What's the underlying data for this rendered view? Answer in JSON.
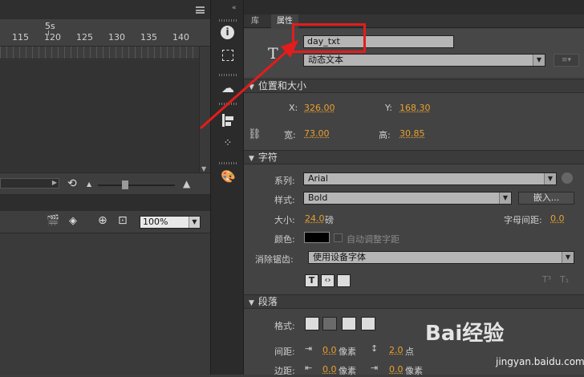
{
  "timeline": {
    "marker": "5s",
    "ruler": [
      "115",
      "120",
      "125",
      "130",
      "135",
      "140"
    ],
    "zoom": "100%"
  },
  "props": {
    "tabs": [
      "库",
      "属性"
    ],
    "instance_name": "day_txt",
    "text_type": "动态文本",
    "sections": {
      "position": "位置和大小",
      "character": "字符",
      "paragraph": "段落"
    },
    "position": {
      "x_label": "X:",
      "x": "326.00",
      "y_label": "Y:",
      "y": "168.30",
      "w_label": "宽:",
      "w": "73.00",
      "h_label": "高:",
      "h": "30.85"
    },
    "character": {
      "family_label": "系列:",
      "family": "Arial",
      "style_label": "样式:",
      "style": "Bold",
      "embed_button": "嵌入...",
      "size_label": "大小:",
      "size": "24.0",
      "size_unit": "磅",
      "letter_spacing_label": "字母间距:",
      "letter_spacing": "0.0",
      "color_label": "颜色:",
      "color": "#000000",
      "auto_kern": "自动调整字距",
      "antialias_label": "消除锯齿:",
      "antialias": "使用设备字体"
    },
    "paragraph": {
      "format_label": "格式:",
      "spacing_label": "间距:",
      "indent": "0.0",
      "indent_unit": "像素",
      "line_spacing": "2.0",
      "line_unit": "点",
      "margin_label": "边距:",
      "left_margin": "0.0",
      "left_unit": "像素",
      "right_margin": "0.0",
      "right_unit": "像素"
    }
  },
  "watermark": {
    "brand": "Bai经验",
    "url": "jingyan.baidu.com"
  },
  "colors": {
    "accent": "#e8a030",
    "highlight": "#e31c1c"
  }
}
